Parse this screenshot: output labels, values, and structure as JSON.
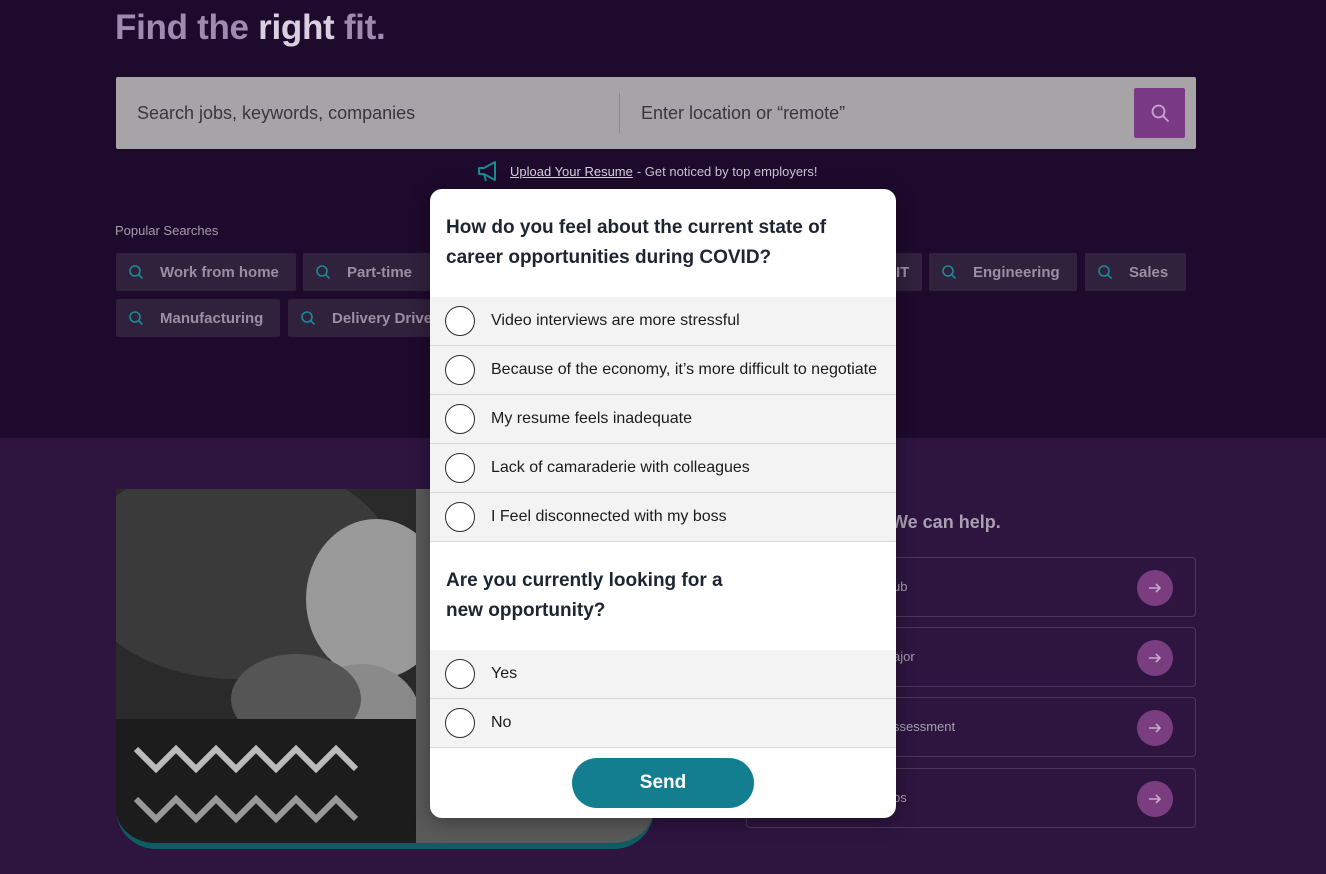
{
  "hero": {
    "title_part1": "Find the ",
    "title_part2": "right",
    "title_part3": " fit."
  },
  "search": {
    "keywords_placeholder": "Search jobs, keywords, companies",
    "location_placeholder": "Enter location or “remote”"
  },
  "upload": {
    "link": "Upload Your Resume",
    "rest": "- Get noticed by top employers!"
  },
  "popular": {
    "label": "Popular Searches",
    "chips": [
      "Work from home",
      "Part-time",
      "IT",
      "Engineering",
      "Sales",
      "Manufacturing",
      "Delivery Drive"
    ]
  },
  "help": {
    "title": "We can help.",
    "cards": [
      "ub",
      "ajor",
      "ssessment",
      "bs"
    ]
  },
  "survey": {
    "q1": {
      "line1": "How do you feel about the current state of",
      "line2": "career opportunities during COVID?"
    },
    "q1_options": [
      "Video interviews are more stressful",
      "Because of the economy, it’s more difficult to negotiate",
      "My resume feels inadequate",
      "Lack of camaraderie with colleagues",
      "I Feel disconnected with my boss"
    ],
    "q2": {
      "line1": "Are you currently looking for a",
      "line2": "new opportunity?"
    },
    "q2_options": [
      "Yes",
      "No"
    ],
    "send_label": "Send"
  },
  "colors": {
    "brand_dark": "#1e0a2d",
    "accent_purple": "#7a3a85",
    "send_teal": "#137e90"
  }
}
